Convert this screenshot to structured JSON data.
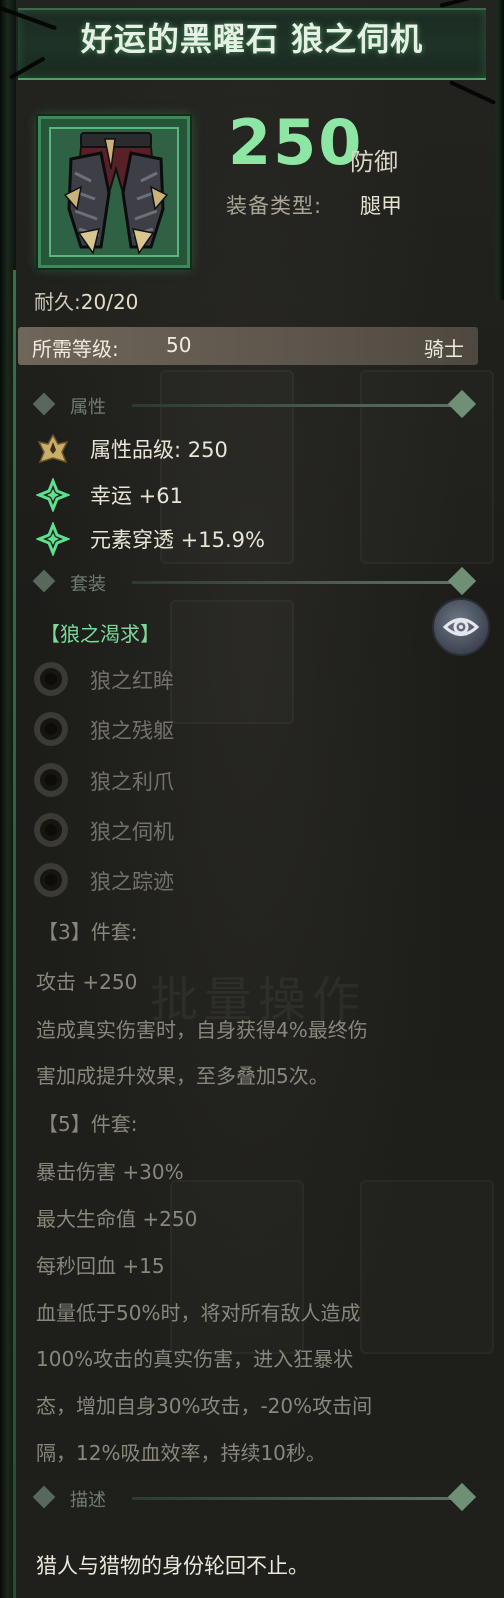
{
  "item": {
    "title": "好运的黑曜石 狼之伺机",
    "defense_value": "250",
    "defense_label": "防御",
    "type_label": "装备类型:",
    "type_value": "腿甲",
    "durability_label": "耐久:",
    "durability_value": "20/20",
    "requirement_label": "所需等级:",
    "requirement_value": "50",
    "class_name": "骑士",
    "icon": "leg-armor-icon"
  },
  "sections": {
    "attributes": "属性",
    "set": "套装",
    "description": "描述"
  },
  "attributes": [
    {
      "icon": "attribute-grade-icon",
      "text": "属性品级: 250"
    },
    {
      "icon": "luck-sparkle-icon",
      "text": "幸运 +61"
    },
    {
      "icon": "element-pierce-sparkle-icon",
      "text": "元素穿透 +15.9%"
    }
  ],
  "set": {
    "name": "【狼之渴求】",
    "pieces": [
      "狼之红眸",
      "狼之残躯",
      "狼之利爪",
      "狼之伺机",
      "狼之踪迹"
    ],
    "bonus3_header": "【3】件套:",
    "bonus3_lines": [
      "攻击 +250",
      "造成真实伤害时，自身获得4%最终伤",
      "害加成提升效果，至多叠加5次。"
    ],
    "bonus5_header": "【5】件套:",
    "bonus5_lines": [
      "暴击伤害 +30%",
      "最大生命值 +250",
      "每秒回血 +15",
      "血量低于50%时，将对所有敌人造成",
      "100%攻击的真实伤害，进入狂暴状",
      "态，增加自身30%攻击，-20%攻击间",
      "隔，12%吸血效率，持续10秒。"
    ]
  },
  "description_text": "猎人与猎物的身份轮回不止。",
  "background_text": "批量操作",
  "colors": {
    "accent_green": "#8ee6a4",
    "set_name": "#7bd99a",
    "inactive_text": "#75716a"
  }
}
